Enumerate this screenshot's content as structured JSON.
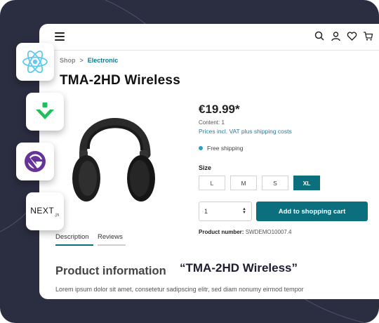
{
  "breadcrumb": {
    "shop": "Shop",
    "separator": ">",
    "current": "Electronic"
  },
  "product": {
    "title": "TMA-2HD Wireless",
    "price": "€19.99*",
    "content": "Content: 1",
    "vat_note": "Prices incl. VAT plus shipping costs",
    "shipping": "Free shipping",
    "size_label": "Size",
    "sizes": [
      "L",
      "M",
      "S",
      "XL"
    ],
    "selected_size": "XL",
    "quantity": "1",
    "add_to_cart": "Add to shopping cart",
    "product_number_label": "Product number:",
    "product_number": "SWDEMO10007.4"
  },
  "tabs": [
    "Description",
    "Reviews"
  ],
  "info": {
    "heading": "Product information",
    "product_quote": "“TMA-2HD Wireless”",
    "lorem": "Lorem ipsum dolor sit amet, consetetur sadipscing elitr, sed diam nonumy eirmod tempor"
  },
  "logos": {
    "next": "NEXT"
  },
  "colors": {
    "accent": "#0b6f7d",
    "background": "#2b2d40",
    "shipping_dot": "#2aa1c4"
  },
  "icons": [
    "menu-icon",
    "search-icon",
    "user-icon",
    "heart-icon",
    "cart-icon",
    "react-logo-icon",
    "vue-logo-icon",
    "gatsby-logo-icon",
    "nextjs-logo-icon"
  ]
}
